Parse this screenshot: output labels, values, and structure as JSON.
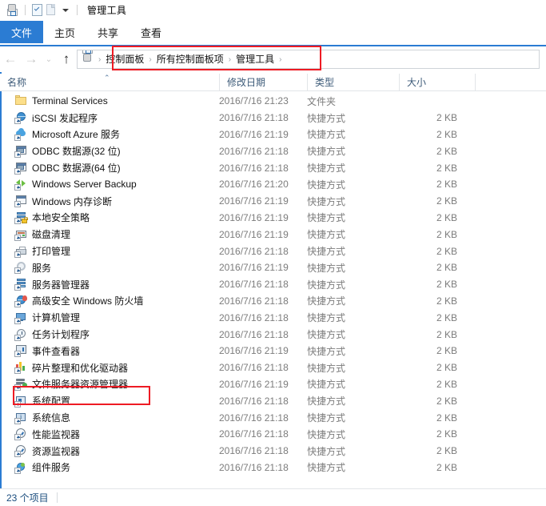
{
  "window": {
    "title": "管理工具",
    "quick_access": [
      {
        "name": "folder-gear-icon",
        "label": "管理工具"
      },
      {
        "name": "properties-icon",
        "label": "属性"
      },
      {
        "name": "new-folder-icon",
        "label": "新建文件夹"
      },
      {
        "name": "chevron-down-icon",
        "label": "自定义快速访问工具栏"
      }
    ]
  },
  "ribbon": {
    "tabs": [
      {
        "label": "文件",
        "active": true
      },
      {
        "label": "主页",
        "active": false
      },
      {
        "label": "共享",
        "active": false
      },
      {
        "label": "查看",
        "active": false
      }
    ]
  },
  "navigation": {
    "back_label": "←",
    "forward_label": "→",
    "recent_label": "⌄",
    "up_label": "↑",
    "breadcrumb": [
      "控制面板",
      "所有控制面板项",
      "管理工具"
    ],
    "separator": "›"
  },
  "columns": [
    {
      "label": "名称",
      "sorted": true,
      "sort_mark": "⌃"
    },
    {
      "label": "修改日期",
      "sorted": false
    },
    {
      "label": "类型",
      "sorted": false
    },
    {
      "label": "大小",
      "sorted": false
    }
  ],
  "files": [
    {
      "name": "Terminal Services",
      "icon": "folder-icon",
      "date": "2016/7/16 21:23",
      "type": "文件夹",
      "size": ""
    },
    {
      "name": "iSCSI 发起程序",
      "icon": "globe-shortcut-icon",
      "date": "2016/7/16 21:18",
      "type": "快捷方式",
      "size": "2 KB"
    },
    {
      "name": "Microsoft Azure 服务",
      "icon": "cloud-shortcut-icon",
      "date": "2016/7/16 21:19",
      "type": "快捷方式",
      "size": "2 KB"
    },
    {
      "name": "ODBC 数据源(32 位)",
      "icon": "odbc-shortcut-icon",
      "date": "2016/7/16 21:18",
      "type": "快捷方式",
      "size": "2 KB"
    },
    {
      "name": "ODBC 数据源(64 位)",
      "icon": "odbc-shortcut-icon",
      "date": "2016/7/16 21:18",
      "type": "快捷方式",
      "size": "2 KB"
    },
    {
      "name": "Windows Server Backup",
      "icon": "backup-shortcut-icon",
      "date": "2016/7/16 21:20",
      "type": "快捷方式",
      "size": "2 KB"
    },
    {
      "name": "Windows 内存诊断",
      "icon": "memory-shortcut-icon",
      "date": "2016/7/16 21:19",
      "type": "快捷方式",
      "size": "2 KB"
    },
    {
      "name": "本地安全策略",
      "icon": "security-policy-icon",
      "date": "2016/7/16 21:19",
      "type": "快捷方式",
      "size": "2 KB"
    },
    {
      "name": "磁盘清理",
      "icon": "disk-cleanup-icon",
      "date": "2016/7/16 21:19",
      "type": "快捷方式",
      "size": "2 KB"
    },
    {
      "name": "打印管理",
      "icon": "printer-icon",
      "date": "2016/7/16 21:18",
      "type": "快捷方式",
      "size": "2 KB"
    },
    {
      "name": "服务",
      "icon": "services-gear-icon",
      "date": "2016/7/16 21:19",
      "type": "快捷方式",
      "size": "2 KB"
    },
    {
      "name": "服务器管理器",
      "icon": "server-manager-icon",
      "date": "2016/7/16 21:18",
      "type": "快捷方式",
      "size": "2 KB"
    },
    {
      "name": "高级安全 Windows 防火墙",
      "icon": "firewall-icon",
      "date": "2016/7/16 21:18",
      "type": "快捷方式",
      "size": "2 KB"
    },
    {
      "name": "计算机管理",
      "icon": "computer-mgmt-icon",
      "date": "2016/7/16 21:18",
      "type": "快捷方式",
      "size": "2 KB"
    },
    {
      "name": "任务计划程序",
      "icon": "task-scheduler-icon",
      "date": "2016/7/16 21:18",
      "type": "快捷方式",
      "size": "2 KB"
    },
    {
      "name": "事件查看器",
      "icon": "event-viewer-icon",
      "date": "2016/7/16 21:19",
      "type": "快捷方式",
      "size": "2 KB"
    },
    {
      "name": "碎片整理和优化驱动器",
      "icon": "defrag-icon",
      "date": "2016/7/16 21:18",
      "type": "快捷方式",
      "size": "2 KB"
    },
    {
      "name": "文件服务器资源管理器",
      "icon": "fsrm-icon",
      "date": "2016/7/16 21:19",
      "type": "快捷方式",
      "size": "2 KB",
      "highlighted": true
    },
    {
      "name": "系统配置",
      "icon": "sysconfig-icon",
      "date": "2016/7/16 21:18",
      "type": "快捷方式",
      "size": "2 KB"
    },
    {
      "name": "系统信息",
      "icon": "sysinfo-icon",
      "date": "2016/7/16 21:18",
      "type": "快捷方式",
      "size": "2 KB"
    },
    {
      "name": "性能监视器",
      "icon": "perfmon-icon",
      "date": "2016/7/16 21:18",
      "type": "快捷方式",
      "size": "2 KB"
    },
    {
      "name": "资源监视器",
      "icon": "resmon-icon",
      "date": "2016/7/16 21:18",
      "type": "快捷方式",
      "size": "2 KB"
    },
    {
      "name": "组件服务",
      "icon": "component-svc-icon",
      "date": "2016/7/16 21:18",
      "type": "快捷方式",
      "size": "2 KB"
    }
  ],
  "status": {
    "item_count": "23 个项目"
  },
  "colors": {
    "accent": "#2b7cd3",
    "annotation": "#ee1b24",
    "header_text": "#3c5a78",
    "secondary_text": "#7c7c7c"
  }
}
